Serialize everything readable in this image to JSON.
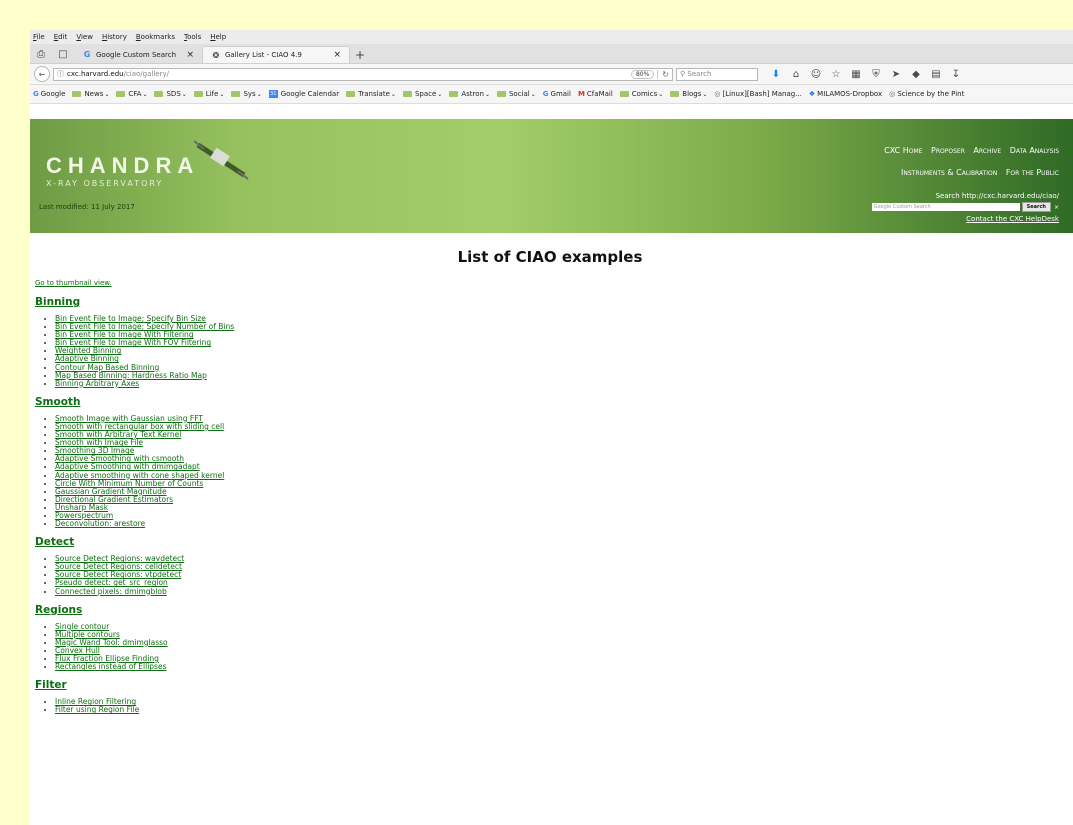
{
  "menu": [
    "File",
    "Edit",
    "View",
    "History",
    "Bookmarks",
    "Tools",
    "Help"
  ],
  "tabs": [
    {
      "title": "Google Custom Search",
      "close": "×"
    },
    {
      "title": "Gallery List - CIAO 4.9",
      "close": "×"
    }
  ],
  "tab_new": "+",
  "nav": {
    "url_host": "cxc.harvard.edu",
    "url_path": "/ciao/gallery/",
    "zoom": "80%",
    "search_placeholder": "Search"
  },
  "bookmarks": [
    {
      "label": "Google",
      "icon": "google-g"
    },
    {
      "label": "News",
      "icon": "folder",
      "menu": true
    },
    {
      "label": "CFA",
      "icon": "folder",
      "menu": true
    },
    {
      "label": "SDS",
      "icon": "folder",
      "menu": true
    },
    {
      "label": "Life",
      "icon": "folder",
      "menu": true
    },
    {
      "label": "Sys",
      "icon": "folder",
      "menu": true
    },
    {
      "label": "Google Calendar",
      "icon": "calendar",
      "cal_day": "31"
    },
    {
      "label": "Translate",
      "icon": "folder",
      "menu": true
    },
    {
      "label": "Space",
      "icon": "folder",
      "menu": true
    },
    {
      "label": "Astron",
      "icon": "folder",
      "menu": true
    },
    {
      "label": "Social",
      "icon": "folder",
      "menu": true
    },
    {
      "label": "Gmail",
      "icon": "google-g"
    },
    {
      "label": "CfaMail",
      "icon": "gmail-m"
    },
    {
      "label": "Comics",
      "icon": "folder",
      "menu": true
    },
    {
      "label": "Blogs",
      "icon": "folder",
      "menu": true
    },
    {
      "label": "[Linux][Bash] Manag...",
      "icon": "globe"
    },
    {
      "label": "MILAMOS-Dropbox",
      "icon": "dropbox"
    },
    {
      "label": "Science by the Pint",
      "icon": "globe"
    }
  ],
  "header": {
    "logo_main": "CHANDRA",
    "logo_sub": "X-RAY OBSERVATORY",
    "last_modified": "Last modified: 11 July 2017",
    "nav_row1": [
      "CXC Home",
      "Proposer",
      "Archive",
      "Data Analysis"
    ],
    "nav_row2": [
      "Instruments & Calibration",
      "For the Public"
    ],
    "search_label": "Search http://cxc.harvard.edu/ciao/",
    "search_placeholder": "Google Custom Search",
    "search_button": "Search",
    "search_clear": "×",
    "helpdesk": "Contact the CXC HelpDesk"
  },
  "page": {
    "title": "List of CIAO examples",
    "thumbnail_link": "Go to thumbnail view."
  },
  "sections": [
    {
      "heading": "Binning",
      "items": [
        "Bin Event File to Image; Specify Bin Size",
        "Bin Event File to Image; Specify Number of Bins",
        "Bin Event File to Image With Filtering",
        "Bin Event File to Image With FOV Filtering",
        "Weighted Binning",
        "Adaptive Binning",
        "Contour Map Based Binning",
        "Map Based Binning: Hardness Ratio Map",
        "Binning Arbitrary Axes"
      ]
    },
    {
      "heading": "Smooth",
      "items": [
        "Smooth Image with Gaussian using FFT",
        "Smooth with rectangular box with sliding cell",
        "Smooth with Arbitrary Text Kernel",
        "Smooth with Image File",
        "Smoothing 3D Image",
        "Adaptive Smoothing with csmooth",
        "Adaptive Smoothing with dmimgadapt",
        "Adaptive smoothing with cone shaped kernel",
        "Circle With Minimum Number of Counts",
        "Gaussian Gradient Magnitude",
        "Directional Gradient Estimators",
        "Unsharp Mask",
        "Powerspectrum",
        "Deconvolution: arestore"
      ]
    },
    {
      "heading": "Detect",
      "items": [
        "Source Detect Regions: wavdetect",
        "Source Detect Regions: celldetect",
        "Source Detect Regions: vtpdetect",
        "Pseudo detect: get_src_region",
        "Connected pixels: dmimgblob"
      ]
    },
    {
      "heading": "Regions",
      "items": [
        "Single contour",
        "Multiple contours",
        "Magic Wand Tool: dmimglasso",
        "Convex Hull",
        "Flux Fraction Ellipse Finding",
        "Rectangles instead of Ellipses"
      ]
    },
    {
      "heading": "Filter",
      "items": [
        "Inline Region Filtering",
        "Filter using Region File"
      ]
    }
  ],
  "colors": {
    "link": "#0e6e12",
    "page_margin": "#ffffcc",
    "header_light": "#a3cd6b",
    "header_dark": "#2f6a25"
  }
}
